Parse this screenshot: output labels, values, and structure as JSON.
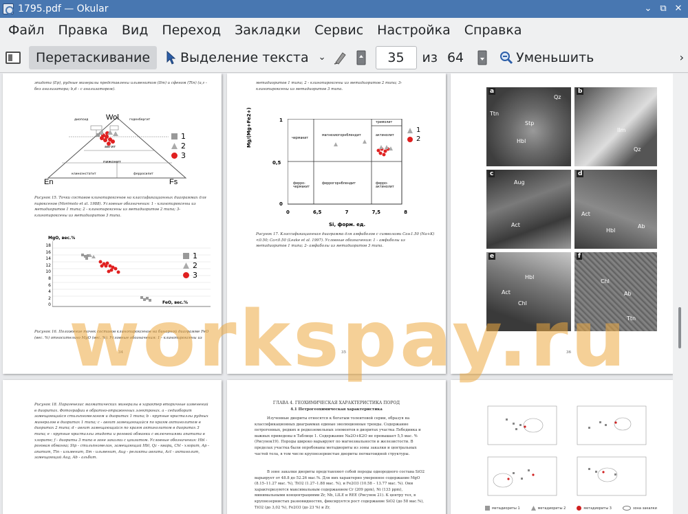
{
  "window": {
    "title": "1795.pdf  — Okular",
    "controls": [
      "⌄",
      "⧉",
      "✕"
    ]
  },
  "menu": [
    "Файл",
    "Правка",
    "Вид",
    "Переход",
    "Закладки",
    "Сервис",
    "Настройка",
    "Справка"
  ],
  "toolbar": {
    "drag_label": "Перетаскивание",
    "select_label": "Выделение текста",
    "page_value": "35",
    "of_label": "из",
    "total_pages": "64",
    "zoom_out_label": "Уменьшить"
  },
  "watermark": "workspay.ru",
  "pages": {
    "p34": {
      "number": "34",
      "top_text": "эпидота (Ep), рудные минералы представлены ильменитом (Ilm) и сфеном (Ttn) (a,г - без анализатора; b,d - с анализатором).",
      "ternary": {
        "apex": "Wol",
        "left": "En",
        "right": "Fs",
        "labels": [
          "диопсид",
          "геденбергит",
          "авгит",
          "пижонит",
          "клиноэнстатит",
          "ферросилит"
        ]
      },
      "legend": [
        "1",
        "2",
        "3"
      ],
      "caption1": "Рисунок 15. Точки составов клинопироксенов на классификационных диаграммах для пироксенов (Morimoto et al. 1988). Условные обозначения: 1 - клинопироксены из метадиоритов 1 типа; 2 - клинопироксены из метадиоритов 2 типа; 3- клинопироксены из метадиоритов 3 типа.",
      "scatter": {
        "ylabel": "MgO, вес.%",
        "xlabel": "FeO, вес.%",
        "yticks": [
          "18",
          "16",
          "14",
          "12",
          "10",
          "8",
          "6",
          "4",
          "2",
          "0"
        ]
      },
      "caption2": "Рисунок 16. Положение точек составов клинопироксенов на бинарной диаграмме FeO (вес. %) относительно MgO (вес. %). Условные обозначения: 1 - клинопироксены из"
    },
    "p35": {
      "number": "35",
      "top_text": "метадиоритов 1 типа; 2 - клинопироксены из метадиоритов 2 типа; 3- клинопироксены из метадиоритов 3 типа.",
      "diagram": {
        "ylabel": "Mg/(Mg+Fe2+)",
        "xlabel": "Si, форм. ед.",
        "yticks": [
          "1",
          "0,5",
          "0"
        ],
        "xticks": [
          "0",
          "6,5",
          "7",
          "7,5",
          "8"
        ],
        "cells": [
          "чермакит",
          "магнезиогорнблендит",
          "тремолит",
          "актинолит",
          "ферро-чермакит",
          "феррогорнблендит",
          "ферро-актинолит"
        ],
        "legend": [
          "1",
          "2"
        ]
      },
      "caption": "Рисунок 17. Классификационная диаграмма для амфиболов с символами Ca≥1.50 (Na+K)<0.50; Ca<0.50 (Leake et al. 1997). Условные обозначения: 1 - амфиболы из метадиоритов 1 типа; 2- амфиболы из метадиоритов 3 типа."
    },
    "p36": {
      "number": "36",
      "photos": [
        {
          "letter": "a",
          "minerals": [
            "Ttn",
            "Qz",
            "Stp",
            "Hbl"
          ]
        },
        {
          "letter": "b",
          "minerals": [
            "Ilm",
            "Qz"
          ]
        },
        {
          "letter": "c",
          "minerals": [
            "Aug",
            "Act"
          ]
        },
        {
          "letter": "d",
          "minerals": [
            "Act",
            "Ab",
            "Hbl"
          ]
        },
        {
          "letter": "e",
          "minerals": [
            "Hbl",
            "Chl",
            "Act"
          ]
        },
        {
          "letter": "f",
          "minerals": [
            "Chl",
            "Ab",
            "Ttn"
          ]
        }
      ]
    },
    "p37": {
      "text": "Рисунок 18. Парагенезис магматических минералы в характер вторичные изменений в диоритах. Фотографии в обратно-отраженных электронах. a - седиоборит замещающийся стильпномеланом и диоритах 1 типа; b - крупные кристаллы рудных минералов в диоритах 1 типа; c - авгит замещающийся по краям актинолитом в диоритах 2 типа; d - авгит замещающийся по краям актинолитом в диоритах 3 типа; e - крупные кристаллы эпидота и роговой обманки с включениями апатита в хлорите; f - диориты 3 типа в зоне закалки с цоизитом. Условные обозначения: Hbl - роговая обманка; Stp - стильпномелан, замещающий Hbl, Qz - кварц, Chl - хлорит, Ap - апатит, Ttn - ильменит, Ilm - ильменит, Aug - реликты авгита, Act - актинолит, замещающий Aug, Ab - альбит."
    },
    "p38": {
      "heading": "ГЛАВА 4. ГЕОХИМИЧЕСКАЯ ХАРАКТЕРИСТИКА ПОРОД",
      "subheading": "4.1 Петрогеохимическая характеристика",
      "para1": "Изученные диориты относятся к богатым толеитовой серии, образуя на классификационных диаграммах единые эволюционные тренды. Содержание петрогенных, редких и редкоземельных элементов в диоритах участка Лебединка и важных приведены в Таблице 1. Содержание Na2O+K2O не превышает 5,5 мас. % (Рисунок19). Породы широко варьируют по магнезиальности и железистости. В пределах участка были опробованы метадиориты из зоны закалки и центральных частей тела, в том числе крупнозернистые диориты пегматоидной структуры.",
      "para2": "В зоне закалки диориты представляют собой породы однородного состава SiO2 варьирует от 48.8 до 52.26 мас.%. Для них характерно умеренное содержание MgO (8.15–11.27 мас. %), TiO2 (1.27–1.88 мас. %), и Fe2O3 (10.58 – 13.77 мас. %). Они характеризуются максимальным содержанием Cr (209 ppm), Ni (133 ppm), минимальными концентрациями Zr, Nb, LILE и REE (Рисунок 21). К центру тел, в крупнозернистых разновидностях, фиксируется рост содержание SiO2 (до 58 мас.%), TiO2 (до 3,02 %), Fe2O3 (до 23 %) и Zr,"
    },
    "p39": {
      "legend": [
        "метадиориты 1",
        "метадиориты 2",
        "метадиориты 3",
        "зона закалки"
      ]
    }
  }
}
